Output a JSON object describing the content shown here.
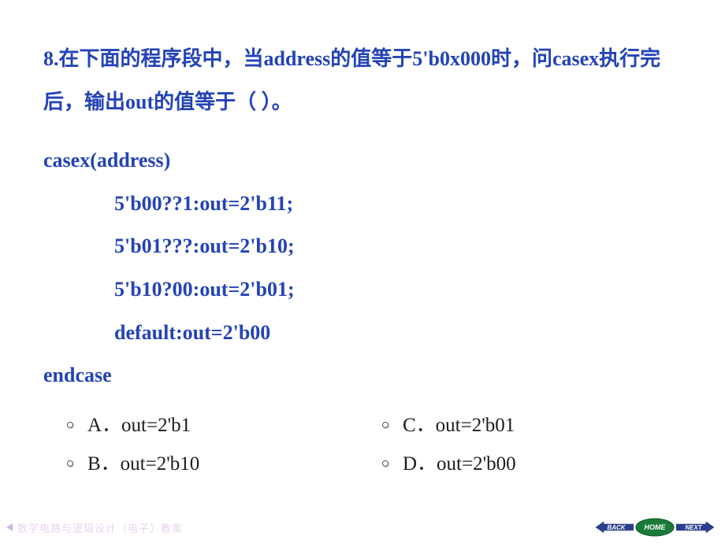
{
  "question": {
    "number": "8.",
    "text": "在下面的程序段中，当address的值等于5'b0x000时，问casex执行完后，输出out的值等于（    ）。"
  },
  "code": {
    "line1": "casex(address)",
    "line2": "5'b00??1:out=2'b11;",
    "line3": "5'b01???:out=2'b10;",
    "line4": "5'b10?00:out=2'b01;",
    "line5": "default:out=2'b00",
    "line6": "endcase"
  },
  "options": {
    "a": "A．out=2'b1",
    "b": "B．out=2'b10",
    "c": "C．out=2'b01",
    "d": "D．out=2'b00"
  },
  "footer": {
    "text": "数字电路与逻辑设计（电子）教案"
  },
  "nav": {
    "back": "BACK",
    "home": "HOME",
    "next": "NEXT"
  }
}
